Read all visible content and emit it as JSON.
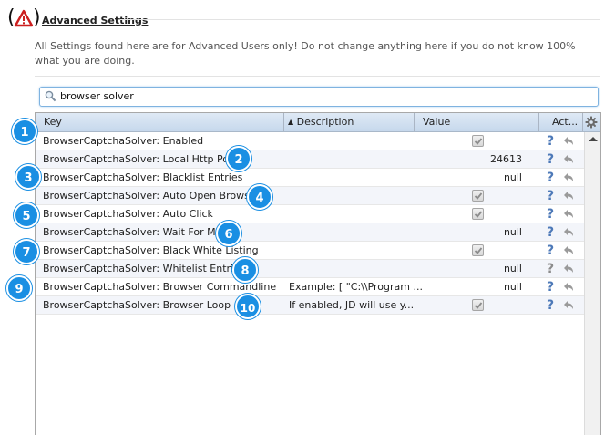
{
  "section": {
    "title": "Advanced Settings",
    "description": "All Settings found here are for Advanced Users only! Do not change anything here if you do not know 100% what you are doing."
  },
  "search": {
    "value": "browser solver"
  },
  "table": {
    "columns": {
      "key": "Key",
      "description": "Description",
      "value": "Value",
      "actions": "Act..."
    },
    "rows": [
      {
        "key": "BrowserCaptchaSolver: Enabled",
        "description": "",
        "value": "",
        "type": "checkbox",
        "checked": true,
        "help_active": true
      },
      {
        "key": "BrowserCaptchaSolver: Local Http Port",
        "description": "",
        "value": "24613",
        "type": "text",
        "help_active": true
      },
      {
        "key": "BrowserCaptchaSolver: Blacklist Entries",
        "description": "",
        "value": "null",
        "type": "text",
        "help_active": true
      },
      {
        "key": "BrowserCaptchaSolver: Auto Open Browser",
        "description": "",
        "value": "",
        "type": "checkbox",
        "checked": true,
        "help_active": true
      },
      {
        "key": "BrowserCaptchaSolver: Auto Click",
        "description": "",
        "value": "",
        "type": "checkbox",
        "checked": true,
        "help_active": true
      },
      {
        "key": "BrowserCaptchaSolver: Wait For Map",
        "description": "",
        "value": "null",
        "type": "text",
        "help_active": true
      },
      {
        "key": "BrowserCaptchaSolver: Black White Listing",
        "description": "",
        "value": "",
        "type": "checkbox",
        "checked": true,
        "help_active": true
      },
      {
        "key": "BrowserCaptchaSolver: Whitelist Entries",
        "description": "",
        "value": "null",
        "type": "text",
        "help_active": false
      },
      {
        "key": "BrowserCaptchaSolver: Browser Commandline",
        "description": "Example: [ \"C:\\\\Program ...",
        "value": "null",
        "type": "text",
        "help_active": true
      },
      {
        "key": "BrowserCaptchaSolver: Browser Loop",
        "description": "If enabled, JD will use y...",
        "value": "",
        "type": "checkbox",
        "checked": true,
        "help_active": true
      }
    ]
  },
  "badges": [
    "1",
    "2",
    "3",
    "4",
    "5",
    "6",
    "7",
    "8",
    "9",
    "10"
  ],
  "colors": {
    "badge": "#1a8fe3",
    "warning": "#cc1f1f",
    "help": "#4d79b8"
  },
  "icons": {
    "warning": "warning-triangle-icon",
    "search": "search-icon",
    "settings": "gear-icon",
    "help": "help-icon",
    "reset": "reset-icon"
  }
}
